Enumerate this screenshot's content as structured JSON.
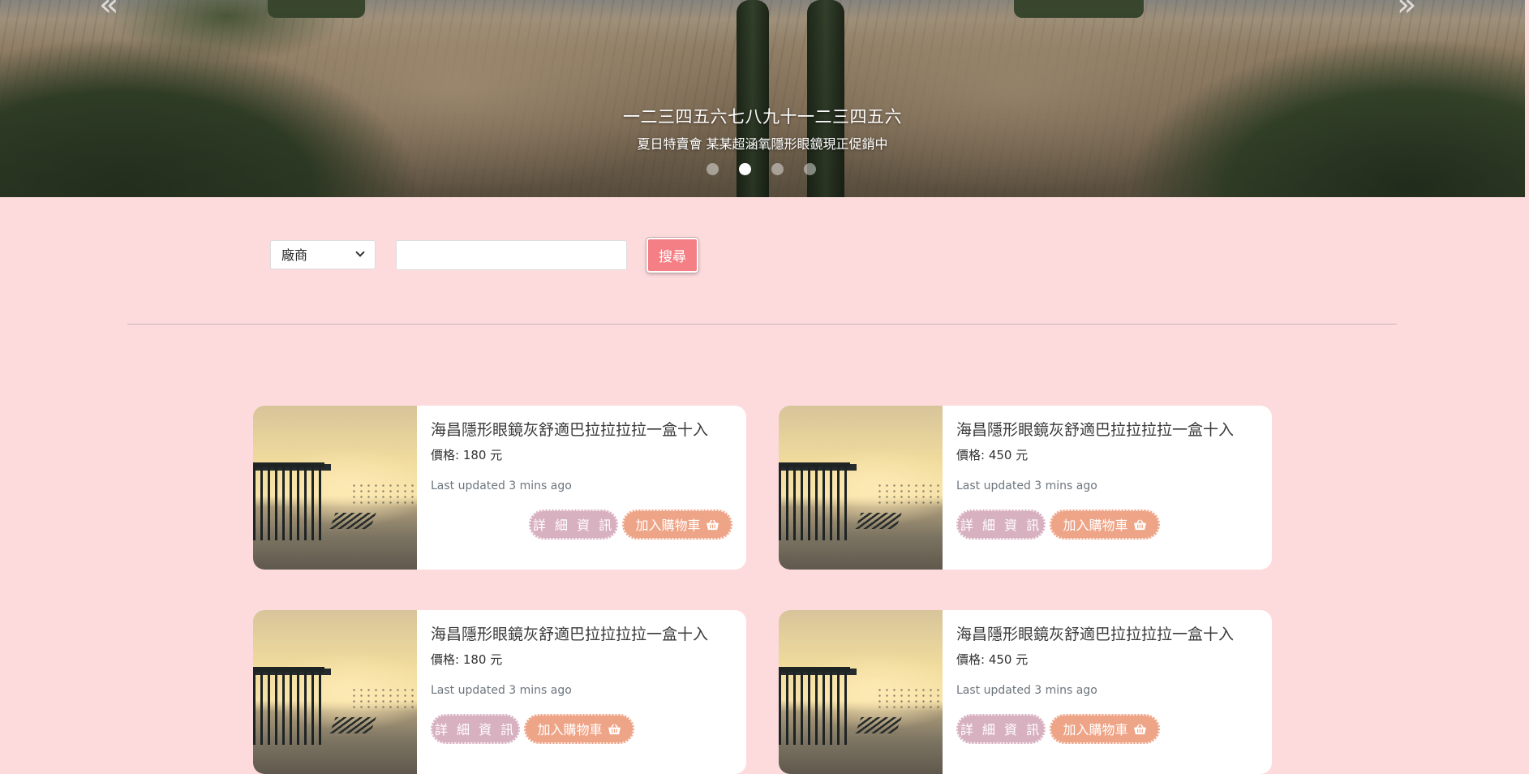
{
  "hero": {
    "prev_icon": "double-chevron-left-icon",
    "next_icon": "double-chevron-right-icon",
    "title": "一二三四五六七八九十一二三四五六",
    "subtitle": "夏日特賣會 某某超涵氧隱形眼鏡現正促銷中",
    "slide_count": 4,
    "active_slide": 2
  },
  "search": {
    "category_selected": "廠商",
    "input_value": "",
    "button_label": "搜尋"
  },
  "products": [
    {
      "title": "海昌隱形眼鏡灰舒適巴拉拉拉拉一盒十入",
      "price": "價格: 180 元",
      "updated": "Last updated 3 mins ago",
      "detail_label": "詳 細 資 訊",
      "cart_label": "加入購物車"
    },
    {
      "title": "海昌隱形眼鏡灰舒適巴拉拉拉拉一盒十入",
      "price": "價格: 450 元",
      "updated": "Last updated 3 mins ago",
      "detail_label": "詳 細 資 訊",
      "cart_label": "加入購物車"
    },
    {
      "title": "海昌隱形眼鏡灰舒適巴拉拉拉拉一盒十入",
      "price": "價格: 180 元",
      "updated": "Last updated 3 mins ago",
      "detail_label": "詳 細 資 訊",
      "cart_label": "加入購物車"
    },
    {
      "title": "海昌隱形眼鏡灰舒適巴拉拉拉拉一盒十入",
      "price": "價格: 450 元",
      "updated": "Last updated 3 mins ago",
      "detail_label": "詳 細 資 訊",
      "cart_label": "加入購物車"
    }
  ],
  "colors": {
    "page_background": "#fddbdd",
    "search_button": "#f47f85",
    "detail_button": "#d8b1c1",
    "cart_button": "#eea487"
  }
}
